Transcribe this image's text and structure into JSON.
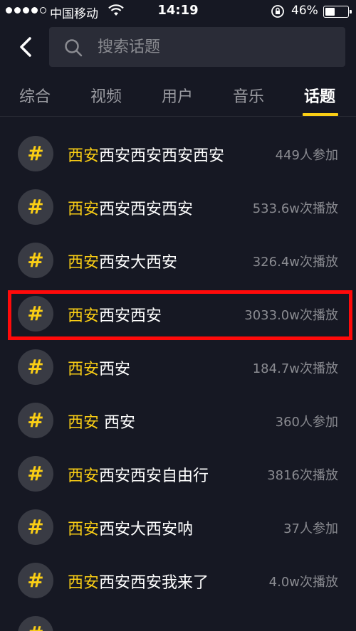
{
  "status_bar": {
    "carrier": "中国移动",
    "time": "14:19",
    "battery_percent": "46%",
    "battery_level": 0.46
  },
  "header": {
    "search_placeholder": "搜索话题"
  },
  "tabs": [
    {
      "label": "综合",
      "active": false
    },
    {
      "label": "视频",
      "active": false
    },
    {
      "label": "用户",
      "active": false
    },
    {
      "label": "音乐",
      "active": false
    },
    {
      "label": "话题",
      "active": true
    }
  ],
  "topics": [
    {
      "hash": "#",
      "highlight": "西安",
      "rest": "西安西安西安西安",
      "meta": "449人参加"
    },
    {
      "hash": "#",
      "highlight": "西安",
      "rest": "西安西安西安",
      "meta": "533.6w次播放"
    },
    {
      "hash": "#",
      "highlight": "西安",
      "rest": "西安大西安",
      "meta": "326.4w次播放"
    },
    {
      "hash": "#",
      "highlight": "西安",
      "rest": "西安西安",
      "meta": "3033.0w次播放"
    },
    {
      "hash": "#",
      "highlight": "西安",
      "rest": "西安",
      "meta": "184.7w次播放"
    },
    {
      "hash": "#",
      "highlight": "西安",
      "rest": " 西安",
      "meta": "360人参加"
    },
    {
      "hash": "#",
      "highlight": "西安",
      "rest": "西安西安自由行",
      "meta": "3816次播放"
    },
    {
      "hash": "#",
      "highlight": "西安",
      "rest": "西安大西安呐",
      "meta": "37人参加"
    },
    {
      "hash": "#",
      "highlight": "西安",
      "rest": "西安西安我来了",
      "meta": "4.0w次播放"
    }
  ],
  "colors": {
    "background": "#161823",
    "accent": "#face15",
    "annotation_box": "#ff0a0a"
  }
}
